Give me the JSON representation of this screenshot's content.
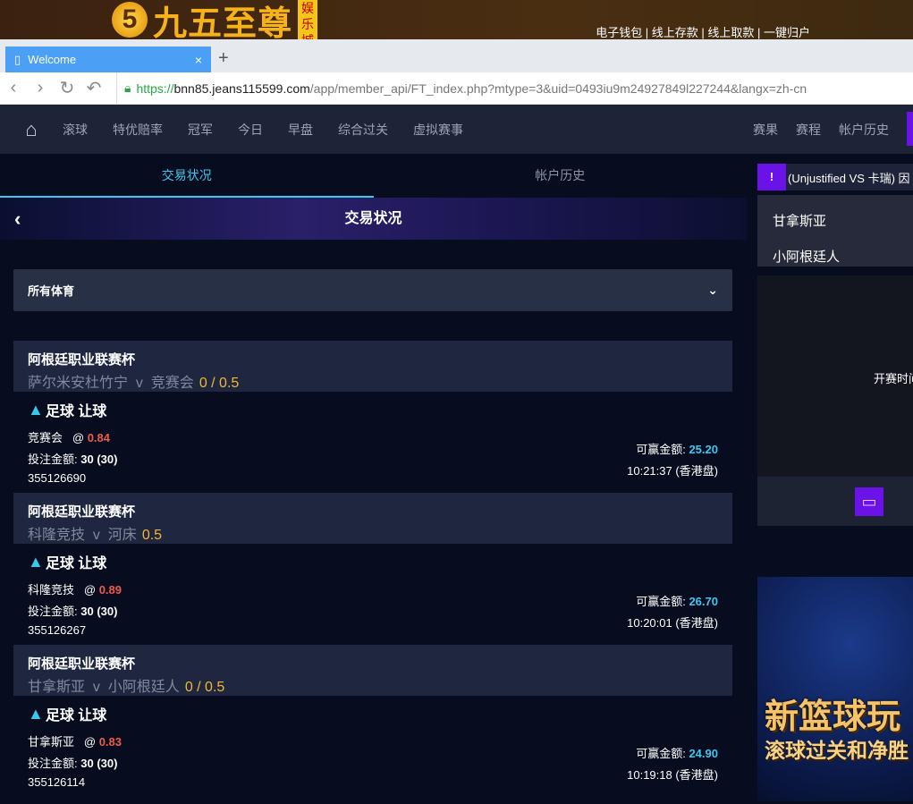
{
  "site": {
    "logo_number": "5",
    "logo_text": "九五至尊",
    "logo_tag": "娱乐城",
    "links": "电子钱包 | 线上存款 | 线上取款 | 一键归户"
  },
  "browser": {
    "tab_title": "Welcome",
    "tab_close": "×",
    "new_tab": "+",
    "url_scheme": "https://",
    "url_host": "bnn85.jeans115599.com",
    "url_path": "/app/member_api/FT_index.php?mtype=3&uid=0493iu9m24927849l227244&langx=zh-cn"
  },
  "nav": {
    "items": [
      "滚球",
      "特优赔率",
      "冠军",
      "今日",
      "早盘",
      "综合过关",
      "虚拟赛事"
    ],
    "right": [
      "赛果",
      "赛程",
      "帐户历史"
    ]
  },
  "tabs": [
    "交易状况",
    "帐户历史"
  ],
  "hero_title": "交易状况",
  "filter": {
    "selected": "所有体育"
  },
  "bets": [
    {
      "league": "阿根廷职业联赛杯",
      "home": "萨尔米安杜竹宁",
      "vs": "v",
      "away": "竞赛会",
      "handicap": "0 / 0.5",
      "type": "足球 让球",
      "pick": "竞赛会",
      "at": "@",
      "odds": "0.84",
      "stake_label": "投注金额:",
      "stake": "30 (30)",
      "win_label": "可赢金额:",
      "win": "25.20",
      "id": "355126690",
      "time": "10:21:37 (香港盘)"
    },
    {
      "league": "阿根廷职业联赛杯",
      "home": "科隆竞技",
      "vs": "v",
      "away": "河床",
      "handicap": "0.5",
      "type": "足球 让球",
      "pick": "科隆竞技",
      "at": "@",
      "odds": "0.89",
      "stake_label": "投注金额:",
      "stake": "30 (30)",
      "win_label": "可赢金额:",
      "win": "26.70",
      "id": "355126267",
      "time": "10:20:01 (香港盘)"
    },
    {
      "league": "阿根廷职业联赛杯",
      "home": "甘拿斯亚",
      "vs": "v",
      "away": "小阿根廷人",
      "handicap": "0 / 0.5",
      "type": "足球 让球",
      "pick": "甘拿斯亚",
      "at": "@",
      "odds": "0.83",
      "stake_label": "投注金额:",
      "stake": "30 (30)",
      "win_label": "可赢金额:",
      "win": "24.90",
      "id": "355126114",
      "time": "10:19:18 (香港盘)"
    }
  ],
  "right": {
    "notice": "(Unjustified VS 卡瑞) 因",
    "team1": "甘拿斯亚",
    "team2": "小阿根廷人",
    "video_text": "开赛时间",
    "ad_title": "新篮球玩",
    "ad_sub": "滚球过关和净胜"
  }
}
